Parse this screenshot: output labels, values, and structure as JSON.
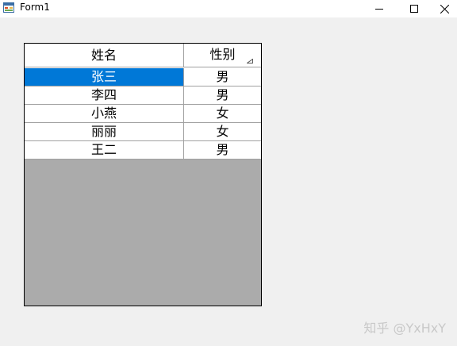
{
  "window": {
    "title": "Form1",
    "icon": "form-app-icon",
    "controls": [
      "minimize-icon",
      "maximize-icon",
      "close-icon"
    ]
  },
  "grid": {
    "columns": [
      "姓名",
      "性别"
    ],
    "sorted_column": "性别",
    "rows": [
      {
        "name": "张三",
        "gender": "男",
        "selected": true
      },
      {
        "name": "李四",
        "gender": "男",
        "selected": false
      },
      {
        "name": "小燕",
        "gender": "女",
        "selected": false
      },
      {
        "name": "丽丽",
        "gender": "女",
        "selected": false
      },
      {
        "name": "王二",
        "gender": "男",
        "selected": false
      }
    ]
  },
  "watermark": "知乎 @YxHxY",
  "colors": {
    "selection": "#0078d7",
    "grid_background": "#ababab",
    "window_background": "#f0f0f0"
  }
}
